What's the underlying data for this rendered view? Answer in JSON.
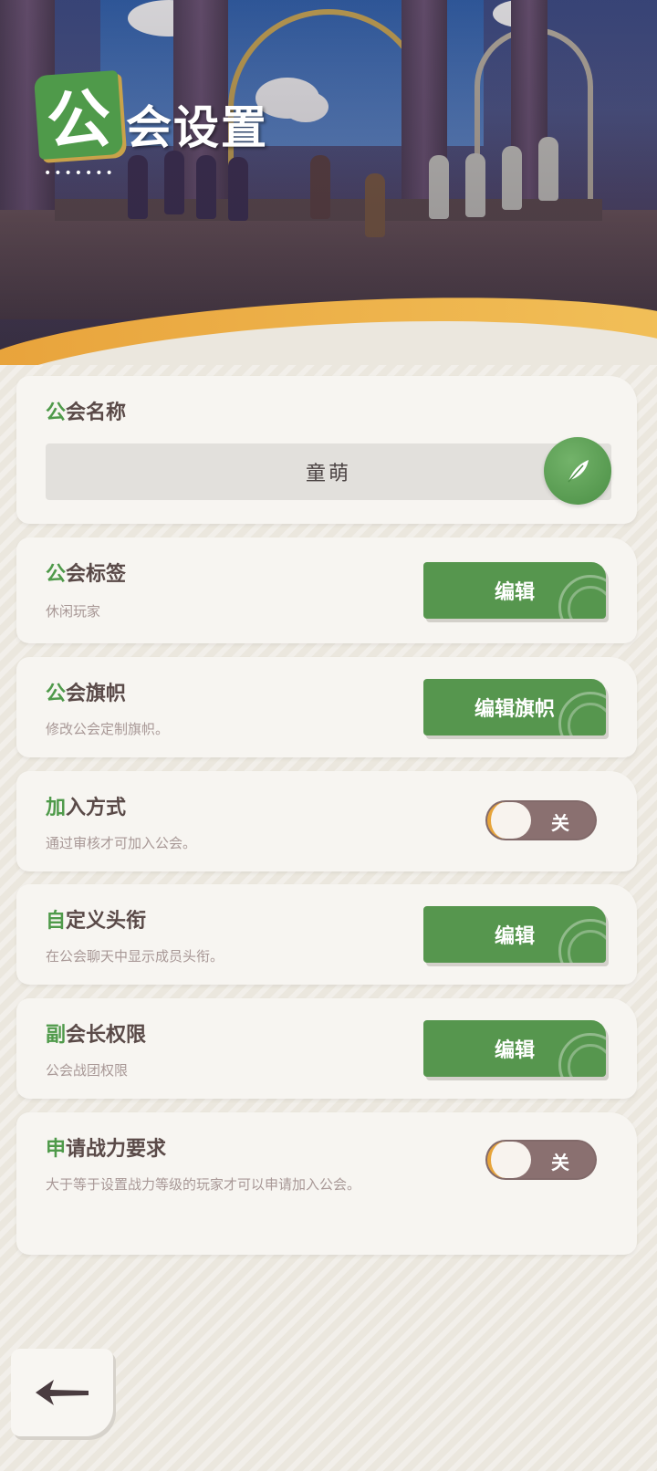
{
  "header": {
    "title_first_char": "公",
    "title_rest": "会设置",
    "title_dots": "•••••••"
  },
  "guild_name": {
    "title_accent": "公",
    "title_rest": "会名称",
    "value": "童萌"
  },
  "guild_tag": {
    "title_accent": "公",
    "title_rest": "会标签",
    "desc": "休闲玩家",
    "button": "编辑"
  },
  "guild_banner": {
    "title_accent": "公",
    "title_rest": "会旗帜",
    "desc": "修改公会定制旗帜。",
    "button": "编辑旗帜"
  },
  "join_mode": {
    "title_accent": "加",
    "title_rest": "入方式",
    "desc": "通过审核才可加入公会。",
    "toggle_label": "关"
  },
  "custom_title": {
    "title_accent": "自",
    "title_rest": "定义头衔",
    "desc": "在公会聊天中显示成员头衔。",
    "button": "编辑"
  },
  "vice_permissions": {
    "title_accent": "副",
    "title_rest": "会长权限",
    "desc": "公会战团权限",
    "button": "编辑"
  },
  "power_requirement": {
    "title_accent": "申",
    "title_rest": "请战力要求",
    "desc": "大于等于设置战力等级的玩家才可以申请加入公会。",
    "toggle_label": "关"
  },
  "colors": {
    "accent_green": "#56964e",
    "text_brown": "#5a4a48",
    "toggle_off": "#8a7070",
    "gold": "#e8a23a"
  },
  "icons": {
    "feather": "feather-icon",
    "back": "back-arrow-icon"
  }
}
